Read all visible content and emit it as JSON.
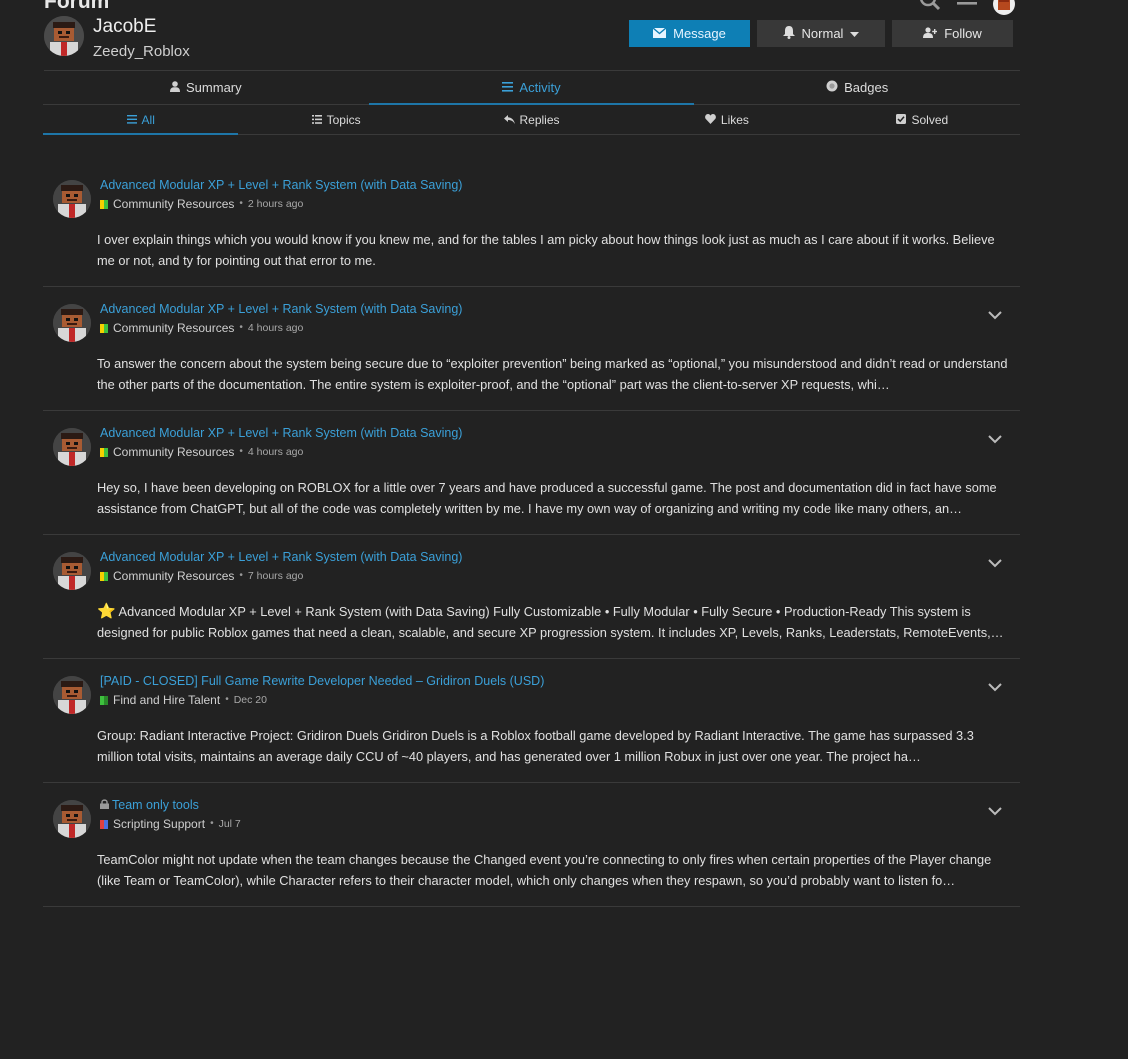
{
  "app": {
    "brand": "Forum"
  },
  "user": {
    "username": "JacobE",
    "fullname": "Zeedy_Roblox"
  },
  "actions": {
    "message_label": "Message",
    "notification_label": "Normal",
    "follow_label": "Follow"
  },
  "main_tabs": [
    {
      "label": "Summary",
      "icon": "user-icon"
    },
    {
      "label": "Activity",
      "icon": "list-icon",
      "active": true
    },
    {
      "label": "Badges",
      "icon": "badge-icon"
    }
  ],
  "sub_tabs": [
    {
      "label": "All",
      "icon": "list-icon",
      "active": true
    },
    {
      "label": "Topics",
      "icon": "bulleted-list-icon"
    },
    {
      "label": "Replies",
      "icon": "reply-icon"
    },
    {
      "label": "Likes",
      "icon": "heart-icon"
    },
    {
      "label": "Solved",
      "icon": "check-square-icon"
    }
  ],
  "posts": [
    {
      "title": "Advanced Modular XP + Level + Rank System (with Data Saving)",
      "category": "Community Resources",
      "time": "2 hours ago",
      "excerpt": "I over explain things which you would know if you knew me, and for the tables I am picky about how things look just as much as I care about if it works. Believe me or not, and ty for pointing out that error to me."
    },
    {
      "title": "Advanced Modular XP + Level + Rank System (with Data Saving)",
      "category": "Community Resources",
      "time": "4 hours ago",
      "excerpt": "To answer the concern about the system being secure due to “exploiter prevention” being marked as “optional,” you misunderstood and didn’t read or understand the other parts of the documentation. The entire system is exploiter-proof, and the “optional” part was the client-to-server XP requests, whi…"
    },
    {
      "title": "Advanced Modular XP + Level + Rank System (with Data Saving)",
      "category": "Community Resources",
      "time": "4 hours ago",
      "excerpt": "Hey so, I have been developing on ROBLOX for a little over 7 years and have produced a successful game. The post and documentation did in fact have some assistance from ChatGPT, but all of the code was completely written by me. I have my own way of organizing and writing my code like many others, an…"
    },
    {
      "title": "Advanced Modular XP + Level + Rank System (with Data Saving)",
      "category": "Community Resources",
      "time": "7 hours ago",
      "star": "⭐",
      "excerpt": "Advanced Modular XP + Level + Rank System (with Data Saving) Fully Customizable • Fully Modular • Fully Secure • Production-Ready This system is designed for public Roblox games that need a clean, scalable, and secure XP progression system. It includes XP, Levels, Ranks, Leaderstats, RemoteEvents,…"
    },
    {
      "title": "[PAID - CLOSED] Full Game Rewrite Developer Needed – Gridiron Duels (USD)",
      "category": "Find and Hire Talent",
      "time": "Dec 20",
      "excerpt": "Group: Radiant Interactive Project: Gridiron Duels Gridiron Duels is a Roblox football game developed by Radiant Interactive. The game has surpassed 3.3 million total visits, maintains an average daily CCU of ~40 players, and has generated over 1 million Robux in just over one year. The project ha…"
    },
    {
      "title": "Team only tools",
      "category": "Scripting Support",
      "time": "Jul 7",
      "excerpt": "TeamColor might not update when the team changes because the Changed event you’re connecting to only fires when certain properties of the Player change (like Team or TeamColor), while Character refers to their character model, which only changes when they respawn, so you’d probably want to listen fo…"
    }
  ],
  "colors": {
    "accent": "#3ba0d8",
    "primary_button": "#0e7fb5",
    "background": "#222222",
    "community_resources": [
      "#f5d000",
      "#3ec13e"
    ],
    "find_talent": [
      "#3ec13e",
      "#2a8a2a"
    ],
    "scripting_support": [
      "#e04040",
      "#4a6fe0"
    ]
  }
}
